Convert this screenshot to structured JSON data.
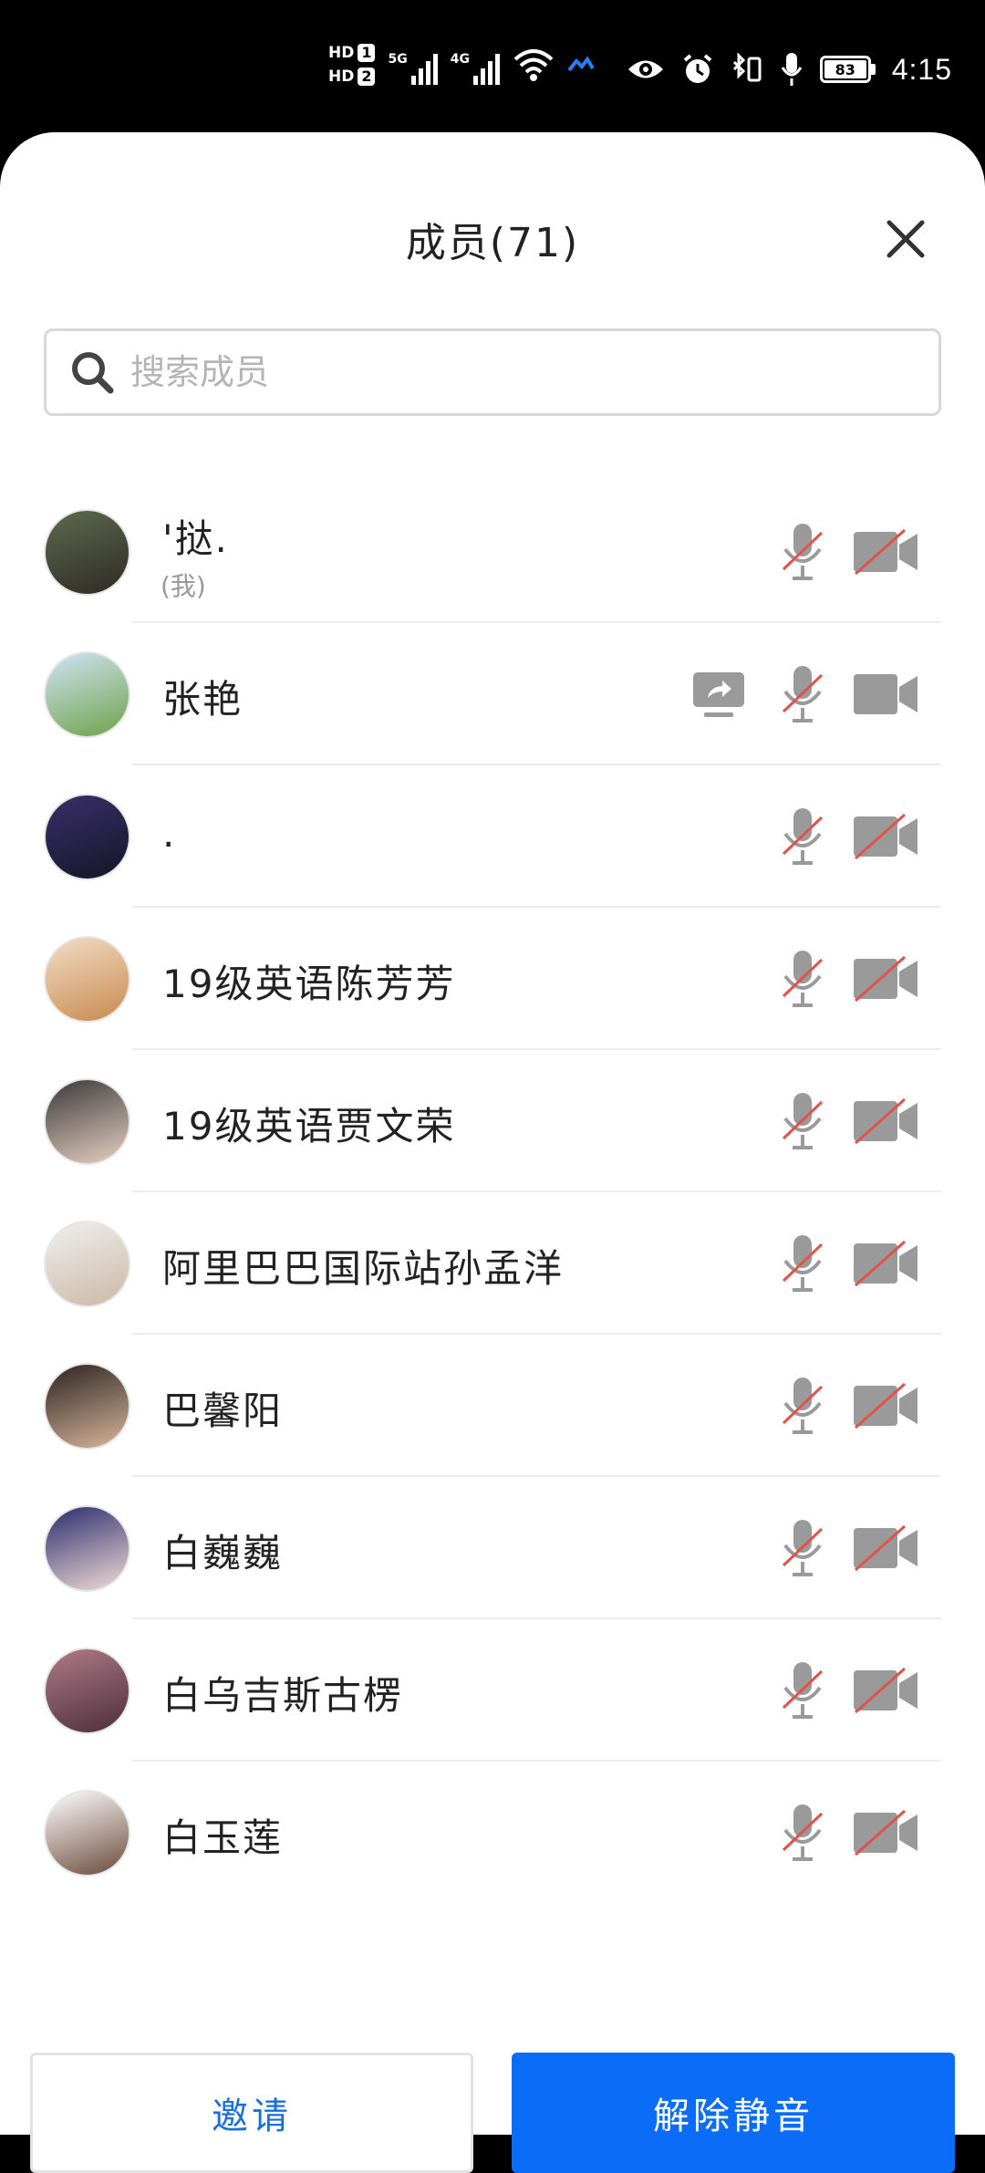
{
  "status_bar": {
    "hd1": "HD",
    "hd1_num": "1",
    "hd2": "HD",
    "hd2_num": "2",
    "net1": "5G",
    "net2": "4G",
    "battery": "83",
    "time": "4:15",
    "icons": [
      "signal-icon",
      "wifi-icon",
      "eye-icon",
      "alarm-icon",
      "bluetooth-vibrate-icon",
      "mic-icon",
      "battery-icon"
    ]
  },
  "sheet": {
    "title": "成员(71)",
    "search_placeholder": "搜索成员"
  },
  "members": [
    {
      "name": "'挞.",
      "sub": "(我)",
      "avatar_colors": [
        "#5d6b4e",
        "#2f2a26"
      ],
      "mic_muted": true,
      "cam_off": true,
      "sharing": false
    },
    {
      "name": "张艳",
      "avatar_colors": [
        "#cfe3f5",
        "#6fa24a"
      ],
      "mic_muted": true,
      "cam_off": false,
      "sharing": true
    },
    {
      "name": ".",
      "avatar_colors": [
        "#3a2f6b",
        "#141626"
      ],
      "mic_muted": true,
      "cam_off": true,
      "sharing": false
    },
    {
      "name": "19级英语陈芳芳",
      "avatar_colors": [
        "#f1ddc6",
        "#c98a4e"
      ],
      "mic_muted": true,
      "cam_off": true,
      "sharing": false
    },
    {
      "name": "19级英语贾文荣",
      "avatar_colors": [
        "#3a3a3a",
        "#e6cfc1"
      ],
      "mic_muted": true,
      "cam_off": true,
      "sharing": false
    },
    {
      "name": "阿里巴巴国际站孙孟洋",
      "avatar_colors": [
        "#efefef",
        "#cbb9a5"
      ],
      "mic_muted": true,
      "cam_off": true,
      "sharing": false
    },
    {
      "name": "巴馨阳",
      "avatar_colors": [
        "#2b2421",
        "#d8b59a"
      ],
      "mic_muted": true,
      "cam_off": true,
      "sharing": false
    },
    {
      "name": "白巍巍",
      "avatar_colors": [
        "#2a2c6e",
        "#f1dcd6"
      ],
      "mic_muted": true,
      "cam_off": true,
      "sharing": false
    },
    {
      "name": "白乌吉斯古楞",
      "avatar_colors": [
        "#b07a8a",
        "#4b2f3a"
      ],
      "mic_muted": true,
      "cam_off": true,
      "sharing": false
    },
    {
      "name": "白玉莲",
      "avatar_colors": [
        "#ffffff",
        "#6b4a3a"
      ],
      "mic_muted": true,
      "cam_off": true,
      "sharing": false
    }
  ],
  "footer": {
    "invite_label": "邀请",
    "unmute_label": "解除静音"
  },
  "colors": {
    "primary": "#0a6cf7",
    "icon_gray": "#9a9a9a",
    "mute_red": "#e0524a"
  }
}
